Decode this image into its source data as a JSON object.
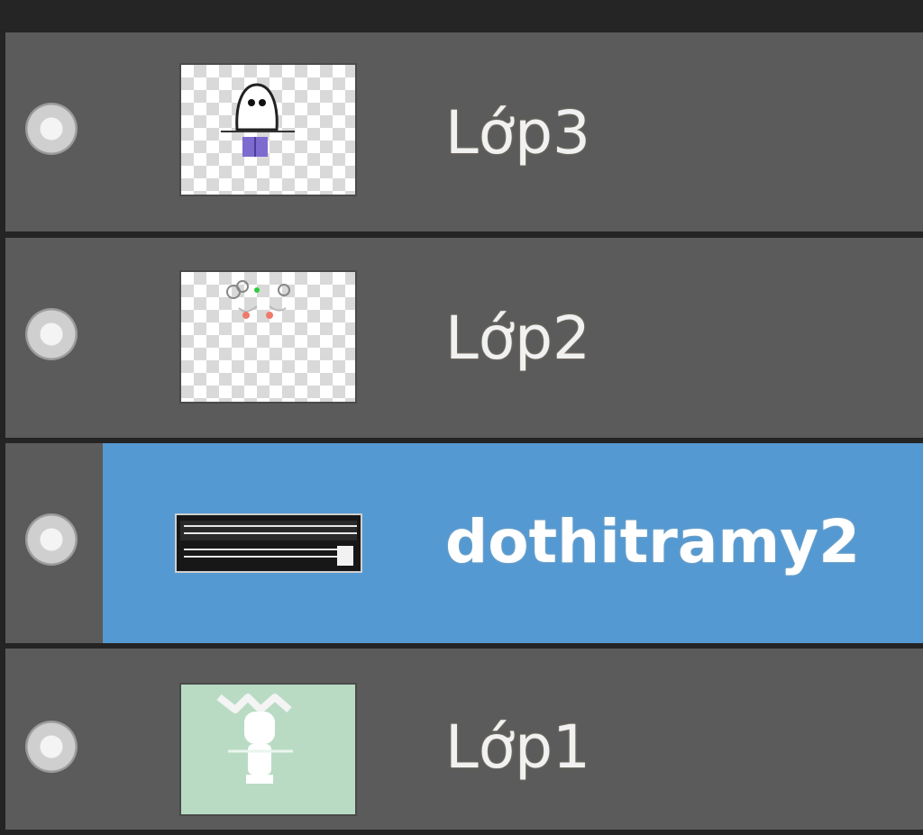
{
  "layers_panel": {
    "layers": [
      {
        "name": "Lớp3",
        "visible": true,
        "selected": false,
        "thumbnail": "ghost-figure-thumbnail"
      },
      {
        "name": "Lớp2",
        "visible": true,
        "selected": false,
        "thumbnail": "face-sketch-thumbnail"
      },
      {
        "name": "dothitramy2",
        "visible": true,
        "selected": true,
        "thumbnail": "text-logo-thumbnail"
      },
      {
        "name": "Lớp1",
        "visible": true,
        "selected": false,
        "thumbnail": "white-figure-green-thumbnail"
      }
    ],
    "colors": {
      "panel_bg": "#242424",
      "row_bg": "#5b5b5b",
      "selected_bg": "#5599d2",
      "text": "#f1f1f1"
    }
  }
}
